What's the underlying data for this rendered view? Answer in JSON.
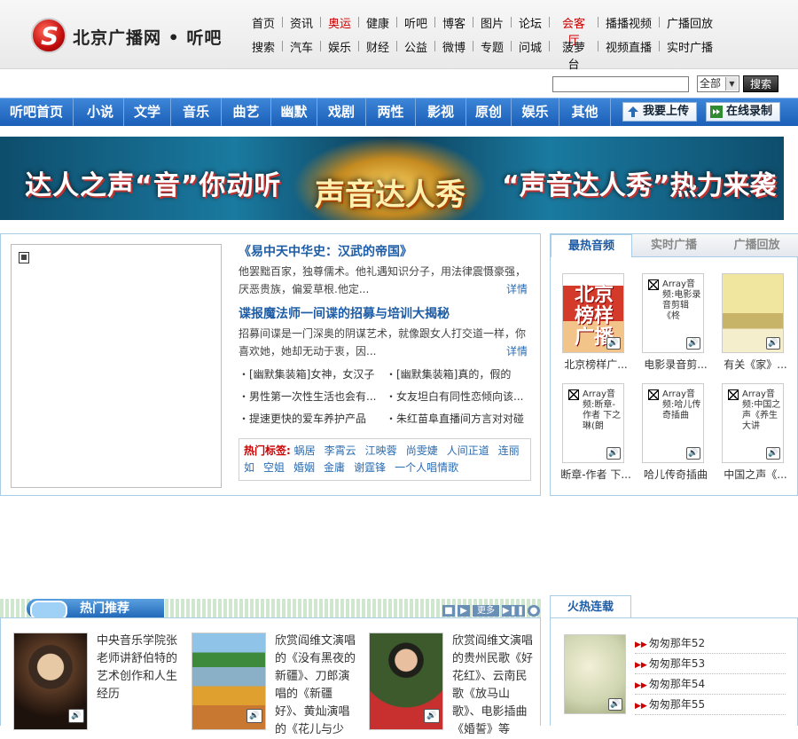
{
  "header": {
    "logo_text": "北京广播网 • 听吧",
    "nav_row1": [
      {
        "label": "首页",
        "hot": false
      },
      {
        "label": "资讯",
        "hot": false
      },
      {
        "label": "奥运",
        "hot": true
      },
      {
        "label": "健康",
        "hot": false
      },
      {
        "label": "听吧",
        "hot": false
      },
      {
        "label": "博客",
        "hot": false
      },
      {
        "label": "图片",
        "hot": false
      },
      {
        "label": "论坛",
        "hot": false
      },
      {
        "label": "会客厅",
        "hot": true
      },
      {
        "label": "播播视频",
        "hot": false
      },
      {
        "label": "广播回放",
        "hot": false
      }
    ],
    "nav_row2": [
      {
        "label": "搜索"
      },
      {
        "label": "汽车"
      },
      {
        "label": "娱乐"
      },
      {
        "label": "财经"
      },
      {
        "label": "公益"
      },
      {
        "label": "微博"
      },
      {
        "label": "专题"
      },
      {
        "label": "问城"
      },
      {
        "label": "菠萝台"
      },
      {
        "label": "视频直播"
      },
      {
        "label": "实时广播"
      }
    ],
    "hot_color": "#cc0000"
  },
  "search": {
    "value": "",
    "select_value": "全部",
    "button_label": "搜索"
  },
  "categories": [
    "听吧首页",
    "小说",
    "文学",
    "音乐",
    "曲艺",
    "幽默",
    "戏剧",
    "两性",
    "影视",
    "原创",
    "娱乐",
    "其他"
  ],
  "category_actions": {
    "upload": "我要上传",
    "record": "在线录制"
  },
  "banner": {
    "left": "达人之声“音”你动听",
    "center": "声音达人秀",
    "right": "“声音达人秀”热力来袭"
  },
  "main": {
    "story1": {
      "title": "《易中天中华史：汉武的帝国》",
      "body": "他罢黜百家，独尊儒术。他礼遇知识分子，用法律震慑豪强，厌恶贵族，偏爱草根.他定...",
      "more": "详情"
    },
    "story2": {
      "title": "谍报魔法师一间谍的招募与培训大揭秘",
      "body": "招募间谍是一门深奥的阴谋艺术，就像跟女人打交道一样，你喜欢她，她却无动于衷，因...",
      "more": "详情"
    },
    "mini_list": [
      "・[幽默集装箱]女神，女汉子",
      "・[幽默集装箱]真的，假的",
      "・男性第一次性生活也会有...",
      "・女友坦白有同性恋倾向该...",
      "・提速更快的爱车养护产品",
      "・朱红苗阜直播间方言对对碰"
    ],
    "tags_label": "热门标签:",
    "tags": [
      "蜗居",
      "李霄云",
      "江映蓉",
      "尚雯婕",
      "人间正道",
      "连丽如",
      "空姐",
      "婚姻",
      "金庸",
      "谢霆锋",
      "一个人唱情歌"
    ]
  },
  "side": {
    "tabs": [
      "最热音频",
      "实时广播",
      "广播回放"
    ],
    "audios": [
      {
        "caption": "北京榜样广...",
        "alt": "北京榜样广播"
      },
      {
        "caption": "电影录音剪...",
        "alt": "Array音频:电影录音剪辑《柊"
      },
      {
        "caption": "有关《家》...",
        "alt": ""
      },
      {
        "caption": "断章-作者 下...",
        "alt": "Array音频:断章-作者 下之琳(朗"
      },
      {
        "caption": "哈儿传奇插曲",
        "alt": "Array音频:哈儿传奇插曲"
      },
      {
        "caption": "中国之声《...",
        "alt": "Array音频:中国之声《养生大讲"
      }
    ]
  },
  "recommend": {
    "title": "热门推荐",
    "more": "更多",
    "items": [
      {
        "text": "中央音乐学院张老师讲舒伯特的艺术创作和人生经历"
      },
      {
        "text": "欣赏阎维文演唱的《没有黑夜的新疆》、刀郎演唱的《新疆好》、黄灿演唱的《花儿与少"
      },
      {
        "text": "欣赏阎维文演唱的贵州民歌《好花红》、云南民歌《放马山歌》、电影插曲《婚誓》等"
      }
    ]
  },
  "serial": {
    "title": "火热连载",
    "episodes": [
      "匆匆那年52",
      "匆匆那年53",
      "匆匆那年54",
      "匆匆那年55"
    ]
  }
}
